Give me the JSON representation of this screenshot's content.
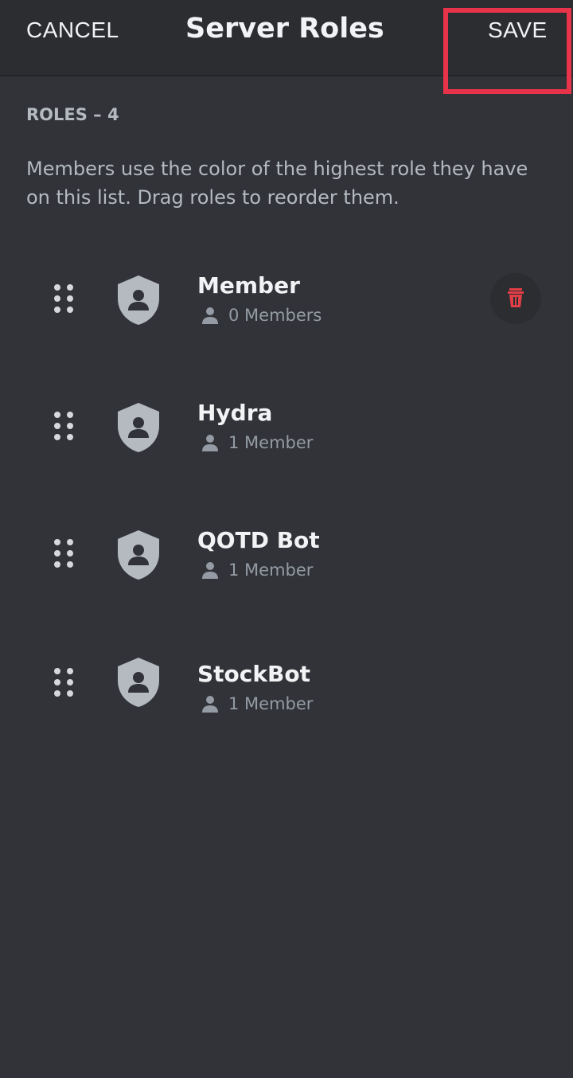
{
  "header": {
    "cancel_label": "CANCEL",
    "title": "Server Roles",
    "save_label": "SAVE"
  },
  "section": {
    "label": "ROLES – 4",
    "description": "Members use the color of the highest role they have on this list. Drag roles to reorder them."
  },
  "roles": [
    {
      "name": "Member",
      "members": "0 Members"
    },
    {
      "name": "Hydra",
      "members": "1 Member"
    },
    {
      "name": "QOTD Bot",
      "members": "1 Member"
    },
    {
      "name": "StockBot",
      "members": "1 Member"
    }
  ],
  "icons": {
    "drag": "drag-handle-icon",
    "role": "shield-user-icon",
    "member": "person-icon",
    "delete": "trash-icon"
  },
  "colors": {
    "background": "#313338",
    "header": "#2b2d31",
    "highlight": "#e8334a",
    "delete": "#e03f45",
    "icon": "#b5bac1"
  }
}
